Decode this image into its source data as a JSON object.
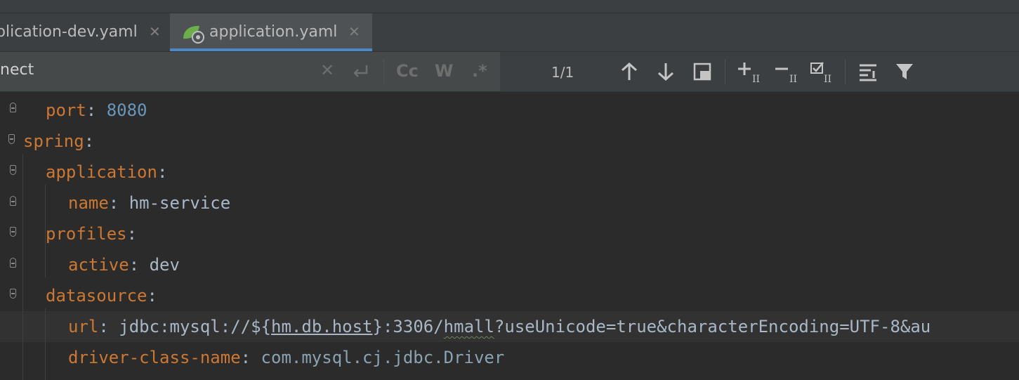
{
  "tabs": [
    {
      "label": "plication-dev.yaml",
      "active": false
    },
    {
      "label": "application.yaml",
      "active": true
    }
  ],
  "find": {
    "query": "nect",
    "match_count": "1/1",
    "options": {
      "match_case": "Cc",
      "words": "W",
      "regex": ".*"
    }
  },
  "icons": {
    "clear": "close-icon",
    "replace": "return-icon",
    "prev": "arrow-up-icon",
    "next": "arrow-down-icon",
    "select_all": "select-occurrences-icon",
    "add_selection": "add-selection-icon",
    "remove_selection": "remove-selection-icon",
    "select_all_occurrences": "checked-selection-icon",
    "filter_options": "filter-list-icon",
    "filter": "funnel-icon"
  },
  "colors": {
    "key": "#cc7832",
    "number": "#6897bb",
    "text": "#a9b7c6",
    "accent": "#4a88c7",
    "background": "#2b2b2b"
  },
  "code": {
    "l1": {
      "key": "port",
      "value": "8080"
    },
    "l2": {
      "key": "spring"
    },
    "l3": {
      "key": "application"
    },
    "l4": {
      "key": "name",
      "value": "hm-service"
    },
    "l5": {
      "key": "profiles"
    },
    "l6": {
      "key": "active",
      "value": "dev"
    },
    "l7": {
      "key": "datasource"
    },
    "l8": {
      "key": "url",
      "v1": "jdbc:mysql://${",
      "v2": "hm.db.host",
      "v3": "}:3306/",
      "v4": "hmall",
      "v5": "?useUnicode=true&characterEncoding=UTF-8&au"
    },
    "l9": {
      "key": "driver-class-name",
      "value": "com.mysql.cj.jdbc.Driver"
    }
  }
}
